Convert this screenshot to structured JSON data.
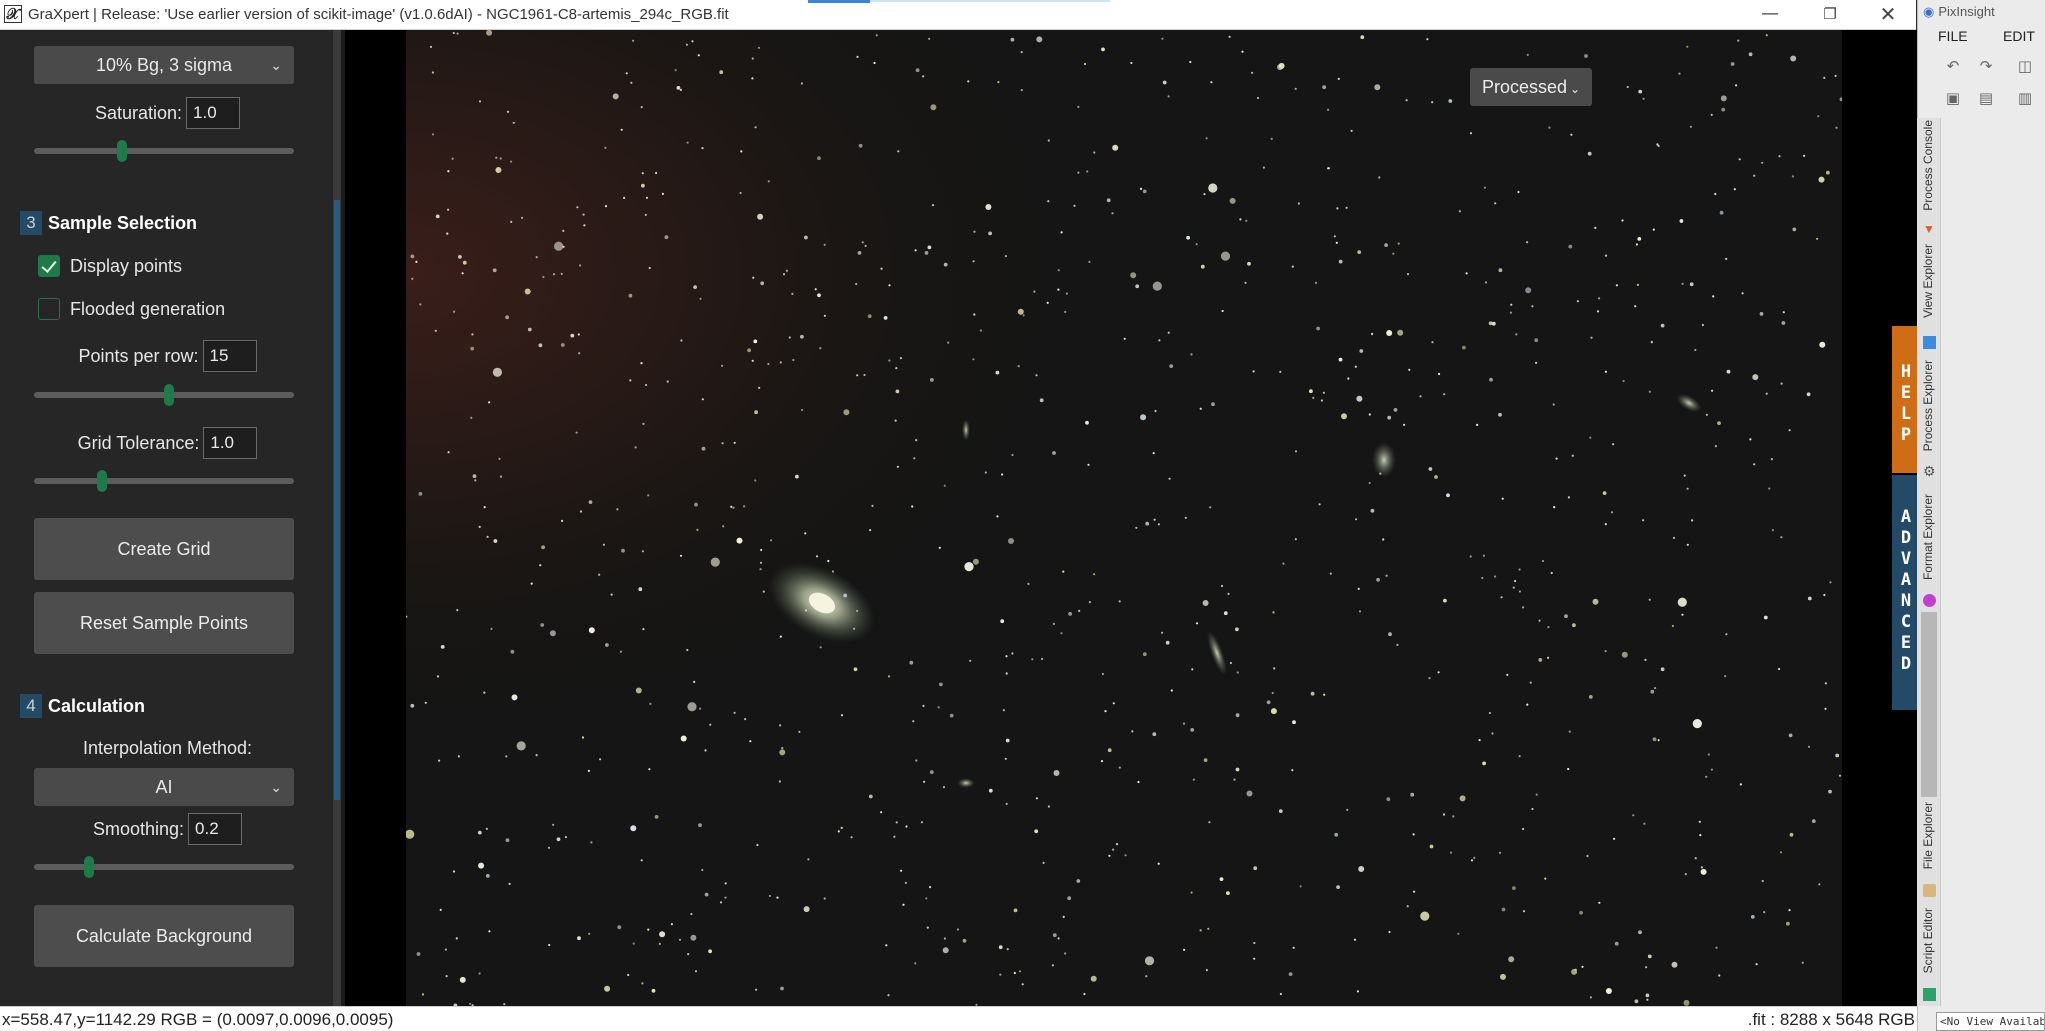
{
  "window": {
    "title": "GraXpert | Release: 'Use earlier version of scikit-image' (v1.0.6dAI) - NGC1961-C8-artemis_294c_RGB.fit",
    "app_icon_glyph": "𝒳",
    "minimize_glyph": "—",
    "restore_glyph": "❐",
    "close_glyph": "✕"
  },
  "left_panel": {
    "stretch_dropdown": {
      "value": "10% Bg, 3 sigma"
    },
    "saturation": {
      "label": "Saturation:",
      "value": "1.0",
      "slider_fraction": 0.34
    },
    "sample_selection": {
      "number": "3",
      "title": "Sample Selection",
      "display_points": {
        "label": "Display points",
        "checked": true
      },
      "flooded_generation": {
        "label": "Flooded generation",
        "checked": false
      },
      "points_per_row": {
        "label": "Points per row:",
        "value": "15",
        "slider_fraction": 0.52
      },
      "grid_tolerance": {
        "label": "Grid Tolerance:",
        "value": "1.0",
        "slider_fraction": 0.26
      },
      "create_grid_button": "Create Grid",
      "reset_button": "Reset Sample Points"
    },
    "calculation": {
      "number": "4",
      "title": "Calculation",
      "interpolation_label": "Interpolation Method:",
      "interpolation_value": "AI",
      "smoothing": {
        "label": "Smoothing:",
        "value": "0.2",
        "slider_fraction": 0.21
      },
      "calculate_button": "Calculate Background"
    }
  },
  "viewer": {
    "display_mode": "Processed",
    "help_tab": "HELP",
    "advanced_tab": "ADVANCED"
  },
  "statusbar": {
    "coords": "x=558.47,y=1142.29  RGB = (0.0097,0.0096,0.0095)",
    "file_info": ".fit : 8288 x 5648 RGB"
  },
  "pixinsight": {
    "logo": "PixInsight",
    "menu_file": "FILE",
    "menu_edit": "EDIT",
    "tabs": [
      "Process Console",
      "View Explorer",
      "Process Explorer",
      "Format Explorer",
      "File Explorer",
      "Script Editor"
    ],
    "status": "<No View Available>"
  },
  "colors": {
    "accent_green": "#1f7a4a",
    "section_blue": "#234a66",
    "help_orange": "#cf6d16"
  }
}
